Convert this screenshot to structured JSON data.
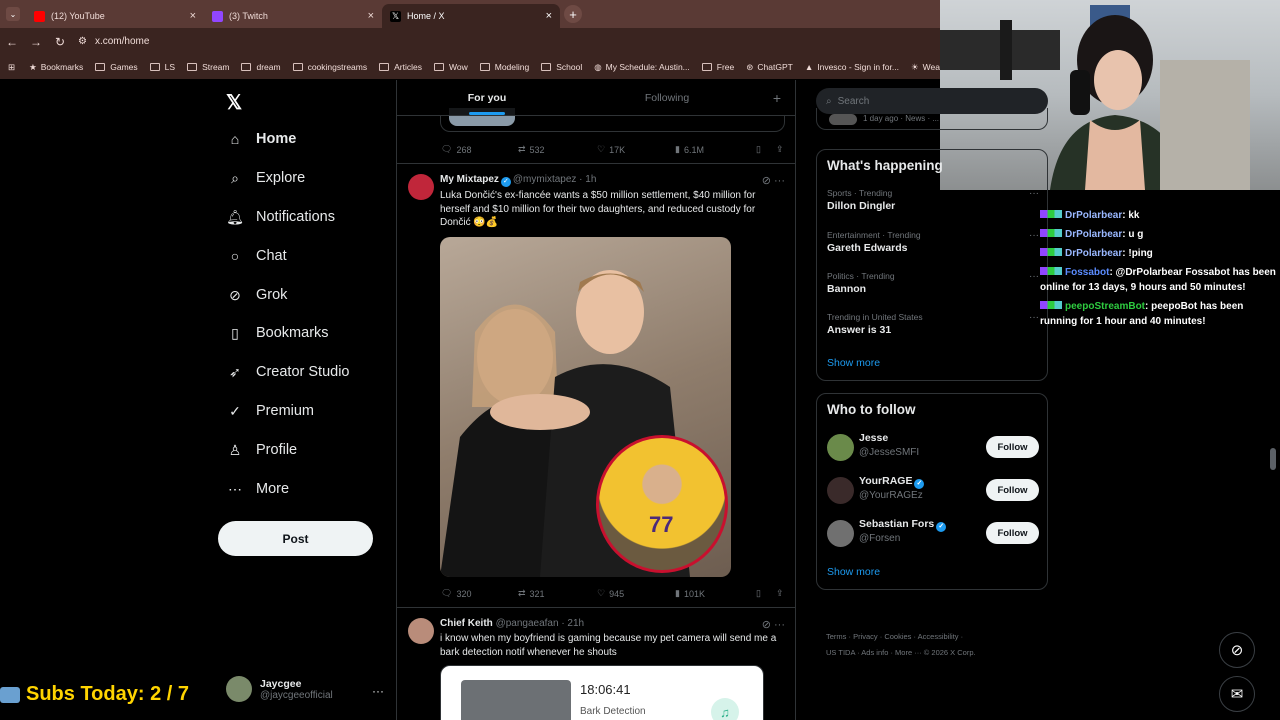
{
  "browser": {
    "tabs": [
      {
        "label": "(12) YouTube",
        "color": "#ff0000"
      },
      {
        "label": "(3) Twitch",
        "color": "#9146ff"
      },
      {
        "label": "Home / X",
        "color": "#ffffff"
      }
    ],
    "url": "x.com/home",
    "bookmarks": [
      "Bookmarks",
      "Games",
      "LS",
      "Stream",
      "dream",
      "cookingstreams",
      "Articles",
      "Wow",
      "Modeling",
      "School",
      "My Schedule: Austin...",
      "Free",
      "ChatGPT",
      "Invesco - Sign in for...",
      "Weathe"
    ]
  },
  "nav": {
    "items": [
      "Home",
      "Explore",
      "Notifications",
      "Chat",
      "Grok",
      "Bookmarks",
      "Creator Studio",
      "Premium",
      "Profile",
      "More"
    ],
    "post_label": "Post",
    "account_name": "Jaycgee",
    "account_handle": "@jaycgeeofficial"
  },
  "overlay": {
    "subs_text": "Subs Today: 2 / 7"
  },
  "feed": {
    "tabs": [
      "For you",
      "Following"
    ],
    "top_actions": {
      "replies": "268",
      "reposts": "532",
      "likes": "17K",
      "views": "6.1M"
    },
    "tweet1": {
      "name": "My Mixtapez",
      "handle": "@mymixtapez · 1h",
      "text": "Luka Dončić's ex-fiancée wants a $50 million settlement, $40 million for herself and $10 million for their two daughters, and reduced custody for Dončić 😳💰",
      "jersey_number": "77",
      "replies": "320",
      "reposts": "321",
      "likes": "945",
      "views": "101K"
    },
    "tweet2": {
      "name": "Chief Keith",
      "handle": "@pangaeafan · 21h",
      "text": "i know when my boyfriend is gaming because my pet camera will send me a bark detection notif whenever he shouts",
      "card_time": "18:06:41",
      "card_label": "Bark Detection"
    }
  },
  "sidebar": {
    "search_placeholder": "Search",
    "top_meta": "1 day ago · News · ...",
    "happening_title": "What's happening",
    "trends": [
      {
        "context": "Sports · Trending",
        "topic": "Dillon Dingler"
      },
      {
        "context": "Entertainment · Trending",
        "topic": "Gareth Edwards"
      },
      {
        "context": "Politics · Trending",
        "topic": "Bannon"
      },
      {
        "context": "Trending in United States",
        "topic": "Answer is 31"
      }
    ],
    "show_more": "Show more",
    "wtf_title": "Who to follow",
    "follow_label": "Follow",
    "suggestions": [
      {
        "name": "Jesse",
        "handle": "@JesseSMFI",
        "verified": false
      },
      {
        "name": "YourRAGE",
        "handle": "@YourRAGEz",
        "verified": true
      },
      {
        "name": "Sebastian Fors",
        "handle": "@Forsen",
        "verified": true
      }
    ],
    "footer1": "Terms · Privacy · Cookies · Accessibility ·",
    "footer2": "US TIDA · Ads info · More ··· © 2026 X Corp."
  },
  "chat": {
    "lines": [
      {
        "user": "DrPolarbear",
        "msg": ": kk",
        "color": "#9ab8ff"
      },
      {
        "user": "DrPolarbear",
        "msg": ": u g",
        "color": "#9ab8ff"
      },
      {
        "user": "DrPolarbear",
        "msg": ": !ping",
        "color": "#9ab8ff"
      },
      {
        "user": "Fossabot",
        "msg": ": @DrPolarbear Fossabot has been online for 13 days, 9 hours and 50 minutes!",
        "color": "#5b8cff"
      },
      {
        "user": "peepoStreamBot",
        "msg": ": peepoBot has been running for 1 hour and 40 minutes!",
        "color": "#2ecc40"
      }
    ]
  }
}
